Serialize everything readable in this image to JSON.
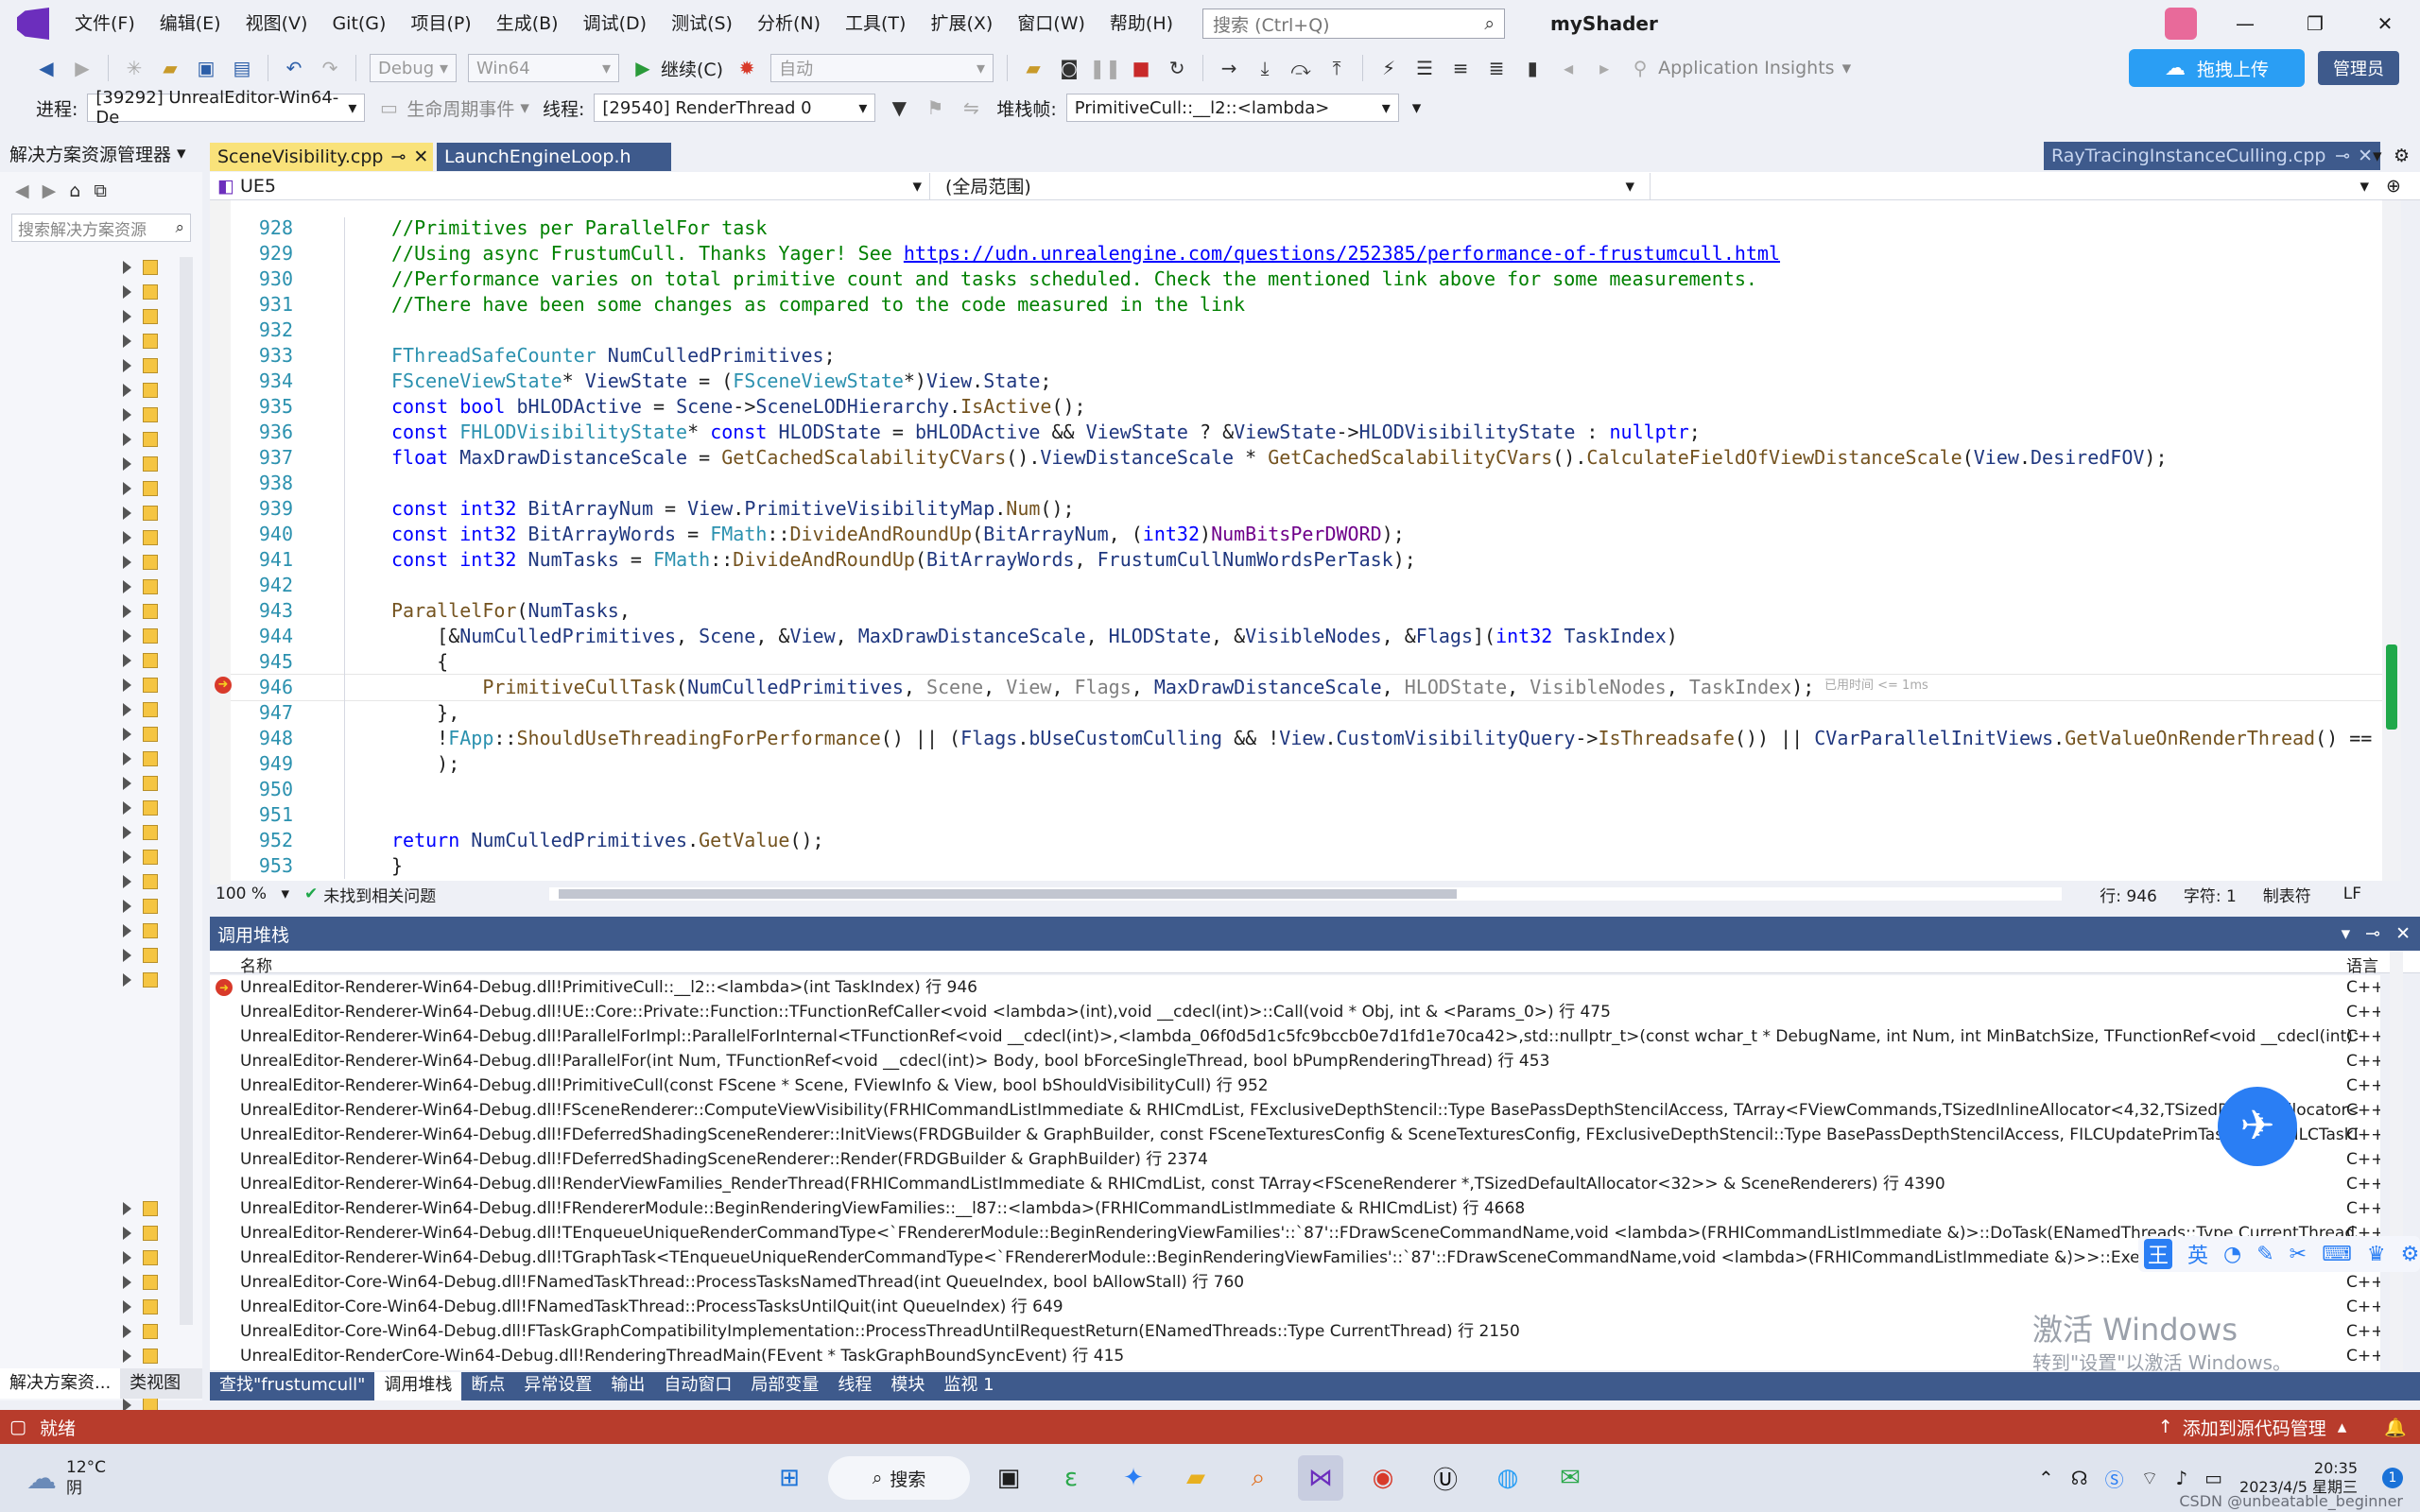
{
  "app": {
    "menu": [
      "文件(F)",
      "编辑(E)",
      "视图(V)",
      "Git(G)",
      "项目(P)",
      "生成(B)",
      "调试(D)",
      "测试(S)",
      "分析(N)",
      "工具(T)",
      "扩展(X)",
      "窗口(W)",
      "帮助(H)"
    ],
    "search_placeholder": "搜索 (Ctrl+Q)",
    "project_name": "myShader",
    "upload_button": "拖拽上传",
    "admin_label": "管理员"
  },
  "toolbar1": {
    "config": "Debug",
    "platform": "Win64",
    "continue": "继续(C)",
    "auto": "自动",
    "insights": "Application Insights"
  },
  "toolbar2": {
    "process_label": "进程:",
    "process_value": "[39292] UnrealEditor-Win64-De",
    "lifecycle": "生命周期事件",
    "thread_label": "线程:",
    "thread_value": "[29540] RenderThread 0",
    "stackframe_label": "堆栈帧:",
    "stackframe_value": "PrimitiveCull::__l2::<lambda>"
  },
  "solution_explorer": {
    "title": "解决方案资源管理器",
    "search_placeholder": "搜索解决方案资源",
    "bottom_tabs": [
      "解决方案资...",
      "类视图"
    ]
  },
  "editor": {
    "tabs": [
      "SceneVisibility.cpp",
      "LaunchEngineLoop.h"
    ],
    "right_tab": "RayTracingInstanceCulling.cpp",
    "project_dropdown": "UE5",
    "scope_dropdown": "(全局范围)",
    "zoom": "100 %",
    "issues": "未找到相关问题",
    "position": {
      "line": "行: 946",
      "col": "字符: 1",
      "tab": "制表符",
      "eol": "LF"
    },
    "elapsed_hint": "已用时间 <= 1ms"
  },
  "code_lines": [
    {
      "n": "928",
      "t": "//Primitives per ParallelFor task"
    },
    {
      "n": "929",
      "t": "//Using async FrustumCull. Thanks Yager! See https://udn.unrealengine.com/questions/252385/performance-of-frustumcull.html"
    },
    {
      "n": "930",
      "t": "//Performance varies on total primitive count and tasks scheduled. Check the mentioned link above for some measurements."
    },
    {
      "n": "931",
      "t": "//There have been some changes as compared to the code measured in the link"
    },
    {
      "n": "932",
      "t": ""
    },
    {
      "n": "933",
      "t": "FThreadSafeCounter NumCulledPrimitives;"
    },
    {
      "n": "934",
      "t": "FSceneViewState* ViewState = (FSceneViewState*)View.State;"
    },
    {
      "n": "935",
      "t": "const bool bHLODActive = Scene->SceneLODHierarchy.IsActive();"
    },
    {
      "n": "936",
      "t": "const FHLODVisibilityState* const HLODState = bHLODActive && ViewState ? &ViewState->HLODVisibilityState : nullptr;"
    },
    {
      "n": "937",
      "t": "float MaxDrawDistanceScale = GetCachedScalabilityCVars().ViewDistanceScale * GetCachedScalabilityCVars().CalculateFieldOfViewDistanceScale(View.DesiredFOV);"
    },
    {
      "n": "938",
      "t": ""
    },
    {
      "n": "939",
      "t": "const int32 BitArrayNum = View.PrimitiveVisibilityMap.Num();"
    },
    {
      "n": "940",
      "t": "const int32 BitArrayWords = FMath::DivideAndRoundUp(BitArrayNum, (int32)NumBitsPerDWORD);"
    },
    {
      "n": "941",
      "t": "const int32 NumTasks = FMath::DivideAndRoundUp(BitArrayWords, FrustumCullNumWordsPerTask);"
    },
    {
      "n": "942",
      "t": ""
    },
    {
      "n": "943",
      "t": "ParallelFor(NumTasks,"
    },
    {
      "n": "944",
      "t": "    [&NumCulledPrimitives, Scene, &View, MaxDrawDistanceScale, HLODState, &VisibleNodes, &Flags](int32 TaskIndex)"
    },
    {
      "n": "945",
      "t": "    {"
    },
    {
      "n": "946",
      "t": "        PrimitiveCullTask(NumCulledPrimitives, Scene, View, Flags, MaxDrawDistanceScale, HLODState, VisibleNodes, TaskIndex);"
    },
    {
      "n": "947",
      "t": "    },"
    },
    {
      "n": "948",
      "t": "    !FApp::ShouldUseThreadingForPerformance() || (Flags.bUseCustomCulling && !View.CustomVisibilityQuery->IsThreadsafe()) || CVarParallelInitViews.GetValueOnRenderThread() == ("
    },
    {
      "n": "949",
      "t": "    );"
    },
    {
      "n": "950",
      "t": ""
    },
    {
      "n": "951",
      "t": ""
    },
    {
      "n": "952",
      "t": "return NumCulledPrimitives.GetValue();"
    },
    {
      "n": "953",
      "t": "}"
    }
  ],
  "callstack": {
    "title": "调用堆栈",
    "col_name": "名称",
    "col_lang": "语言",
    "rows": [
      {
        "name": "UnrealEditor-Renderer-Win64-Debug.dll!PrimitiveCull::__l2::<lambda>(int TaskIndex) 行 946",
        "lang": "C++"
      },
      {
        "name": "UnrealEditor-Renderer-Win64-Debug.dll!UE::Core::Private::Function::TFunctionRefCaller<void <lambda>(int),void __cdecl(int)>::Call(void * Obj, int & <Params_0>) 行 475",
        "lang": "C++"
      },
      {
        "name": "UnrealEditor-Renderer-Win64-Debug.dll!ParallelForImpl::ParallelForInternal<TFunctionRef<void __cdecl(int)>,<lambda_06f0d5d1c5fc9bccb0e7d1fd1e70ca42>,std::nullptr_t>(const wchar_t * DebugName, int Num, int MinBatchSize, TFunctionRef<void __cdecl(int)> Body, ParallelFor:...",
        "lang": "C++"
      },
      {
        "name": "UnrealEditor-Renderer-Win64-Debug.dll!ParallelFor(int Num, TFunctionRef<void __cdecl(int)> Body, bool bForceSingleThread, bool bPumpRenderingThread) 行 453",
        "lang": "C++"
      },
      {
        "name": "UnrealEditor-Renderer-Win64-Debug.dll!PrimitiveCull(const FScene * Scene, FViewInfo & View, bool bShouldVisibilityCull) 行 952",
        "lang": "C++"
      },
      {
        "name": "UnrealEditor-Renderer-Win64-Debug.dll!FSceneRenderer::ComputeViewVisibility(FRHICommandListImmediate & RHICmdList, FExclusiveDepthStencil::Type BasePassDepthStencilAccess, TArray<FViewCommands,TSizedInlineAllocator<4,32,TSizedDefaultAllocator<32>>> & ViewCo...",
        "lang": "C++"
      },
      {
        "name": "UnrealEditor-Renderer-Win64-Debug.dll!FDeferredShadingSceneRenderer::InitViews(FRDGBuilder & GraphBuilder, const FSceneTexturesConfig & SceneTexturesConfig, FExclusiveDepthStencil::Type BasePassDepthStencilAccess, FILCUpdatePrimTaskData & ILCTaskData, FI...Cullin...",
        "lang": "C++"
      },
      {
        "name": "UnrealEditor-Renderer-Win64-Debug.dll!FDeferredShadingSceneRenderer::Render(FRDGBuilder & GraphBuilder) 行 2374",
        "lang": "C++"
      },
      {
        "name": "UnrealEditor-Renderer-Win64-Debug.dll!RenderViewFamilies_RenderThread(FRHICommandListImmediate & RHICmdList, const TArray<FSceneRenderer *,TSizedDefaultAllocator<32>> & SceneRenderers) 行 4390",
        "lang": "C++"
      },
      {
        "name": "UnrealEditor-Renderer-Win64-Debug.dll!FRendererModule::BeginRenderingViewFamilies::__l87::<lambda>(FRHICommandListImmediate & RHICmdList) 行 4668",
        "lang": "C++"
      },
      {
        "name": "UnrealEditor-Renderer-Win64-Debug.dll!TEnqueueUniqueRenderCommandType<`FRendererModule::BeginRenderingViewFamilies'::`87'::FDrawSceneCommandName,void <lambda>(FRHICommandListImmediate &)>::DoTask(ENamedThreads::Type CurrentThread, const TRefCountPt...",
        "lang": "C++"
      },
      {
        "name": "UnrealEditor-Renderer-Win64-Debug.dll!TGraphTask<TEnqueueUniqueRenderCommandType<`FRendererModule::BeginRenderingViewFamilies'::`87'::FDrawSceneCommandName,void <lambda>(FRHICommandListImmediate &)>>::ExecuteTask(TArray<FBas...",
        "lang": "C++"
      },
      {
        "name": "UnrealEditor-Core-Win64-Debug.dll!FNamedTaskThread::ProcessTasksNamedThread(int QueueIndex, bool bAllowStall) 行 760",
        "lang": "C++"
      },
      {
        "name": "UnrealEditor-Core-Win64-Debug.dll!FNamedTaskThread::ProcessTasksUntilQuit(int QueueIndex) 行 649",
        "lang": "C++"
      },
      {
        "name": "UnrealEditor-Core-Win64-Debug.dll!FTaskGraphCompatibilityImplementation::ProcessThreadUntilRequestReturn(ENamedThreads::Type CurrentThread) 行 2150",
        "lang": "C++"
      },
      {
        "name": "UnrealEditor-RenderCore-Win64-Debug.dll!RenderingThreadMain(FEvent * TaskGraphBoundSyncEvent) 行 415",
        "lang": "C++"
      }
    ],
    "bottom_tabs": [
      "查找\"frustumcull\"",
      "调用堆栈",
      "断点",
      "异常设置",
      "输出",
      "自动窗口",
      "局部变量",
      "线程",
      "模块",
      "监视 1"
    ]
  },
  "watermark": {
    "line1": "激活 Windows",
    "line2": "转到\"设置\"以激活 Windows。"
  },
  "status": {
    "ready": "就绪",
    "source_control": "添加到源代码管理"
  },
  "taskbar": {
    "weather_temp": "12°C",
    "weather_desc": "阴",
    "search": "搜索",
    "time": "20:35",
    "date": "2023/4/5 星期三",
    "csdn": "CSDN @unbeatable_beginner"
  },
  "ime": {
    "lang": "英"
  }
}
